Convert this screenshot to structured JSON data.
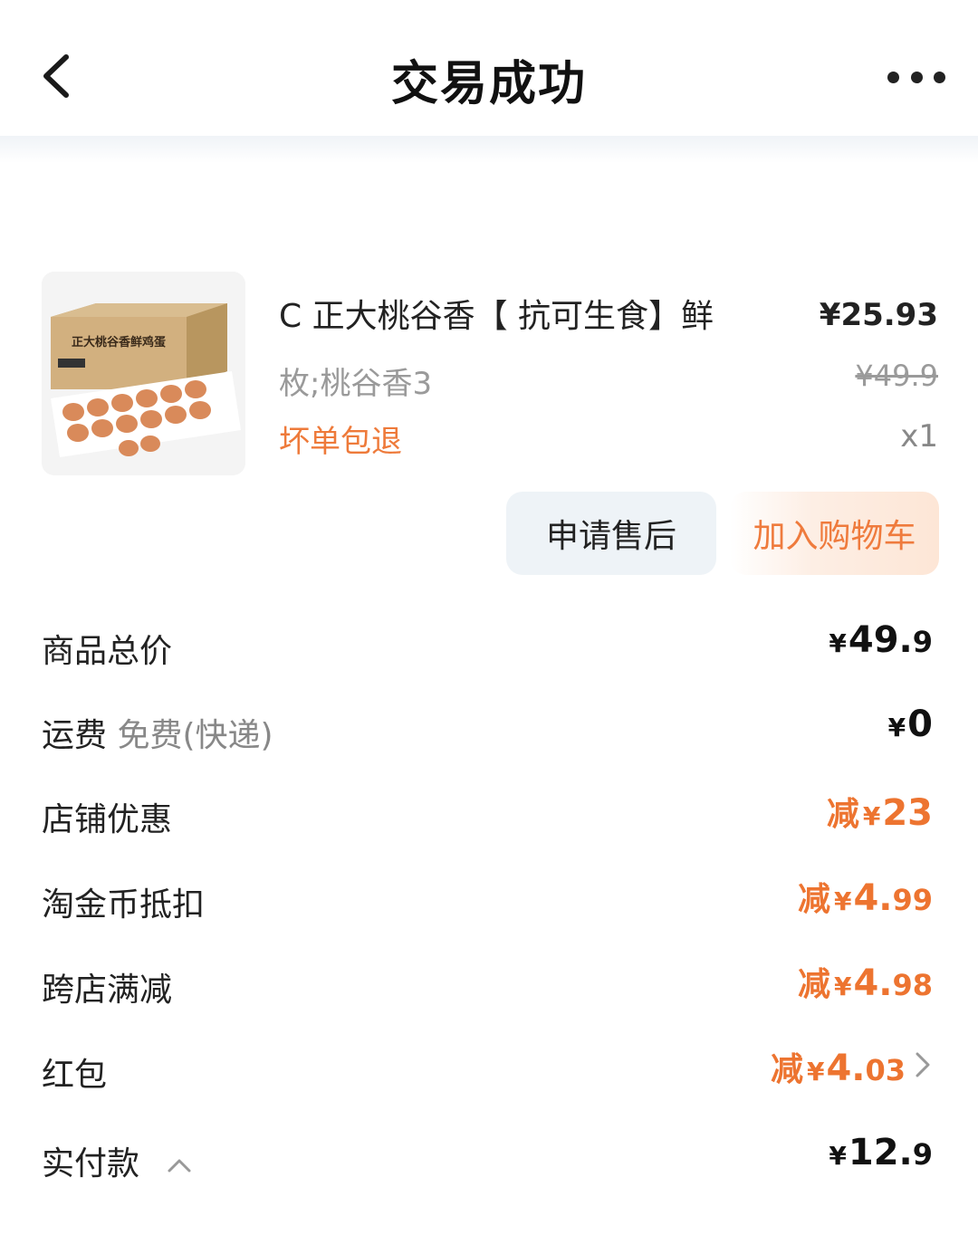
{
  "header": {
    "title": "交易成功",
    "back_icon": "chevron-left-icon",
    "more_icon": "more-dots-icon"
  },
  "product": {
    "image_label": "正大桃谷香鲜鸡蛋",
    "name": "C  正大桃谷香【  抗可生食】鲜",
    "price": "¥25.93",
    "spec": "枚;桃谷香3",
    "original_price": "¥49.9",
    "tag": "坏单包退",
    "quantity": "x1"
  },
  "actions": {
    "after_sale": "申请售后",
    "add_cart": "加入购物车"
  },
  "summary": {
    "goods_total": {
      "label": "商品总价",
      "currency": "¥",
      "int": "49.",
      "dec": "9"
    },
    "shipping": {
      "label": "运费",
      "sub": "免费(快递)",
      "currency": "¥",
      "int": "0",
      "dec": ""
    },
    "shop_discount": {
      "label": "店铺优惠",
      "prefix": "减",
      "currency": "¥",
      "int": "23",
      "dec": ""
    },
    "coin": {
      "label": "淘金币抵扣",
      "prefix": "减",
      "currency": "¥",
      "int": "4.",
      "dec": "99"
    },
    "cross_shop": {
      "label": "跨店满减",
      "prefix": "减",
      "currency": "¥",
      "int": "4.",
      "dec": "98"
    },
    "red_packet": {
      "label": "红包",
      "prefix": "减",
      "currency": "¥",
      "int": "4.",
      "dec": "03"
    },
    "paid": {
      "label": "实付款",
      "currency": "¥",
      "int": "12.",
      "dec": "9"
    }
  },
  "colors": {
    "accent_orange": "#ed7430",
    "button_grey": "#eef3f7"
  }
}
